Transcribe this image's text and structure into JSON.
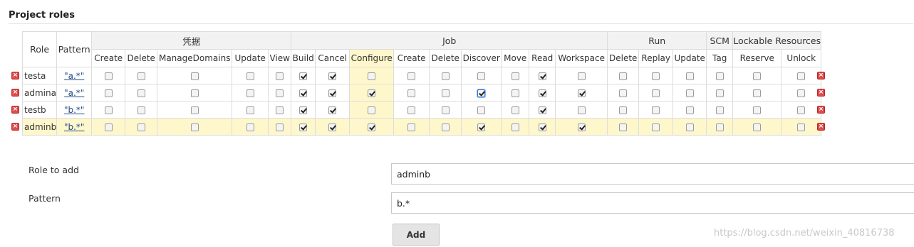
{
  "section_title": "Project roles",
  "table": {
    "role_header": "Role",
    "pattern_header": "Pattern",
    "groups": [
      {
        "name": "凭据",
        "permissions": [
          "Create",
          "Delete",
          "ManageDomains",
          "Update",
          "View"
        ]
      },
      {
        "name": "Job",
        "permissions": [
          "Build",
          "Cancel",
          "Configure",
          "Create",
          "Delete",
          "Discover",
          "Move",
          "Read",
          "Workspace"
        ]
      },
      {
        "name": "Run",
        "permissions": [
          "Delete",
          "Replay",
          "Update"
        ]
      },
      {
        "name": "SCM",
        "permissions": [
          "Tag"
        ]
      },
      {
        "name": "Lockable Resources",
        "permissions": [
          "Reserve",
          "Unlock"
        ]
      }
    ],
    "highlighted_column": "Job/Configure",
    "rows": [
      {
        "role": "testa",
        "pattern": "\"a.*\"",
        "checked": [
          "Job/Build",
          "Job/Cancel",
          "Job/Read"
        ]
      },
      {
        "role": "admina",
        "pattern": "\"a.*\"",
        "checked": [
          "Job/Build",
          "Job/Cancel",
          "Job/Configure",
          "Job/Discover",
          "Job/Read",
          "Job/Workspace"
        ],
        "focused": "Job/Discover"
      },
      {
        "role": "testb",
        "pattern": "\"b.*\"",
        "checked": [
          "Job/Build",
          "Job/Cancel",
          "Job/Read"
        ]
      },
      {
        "role": "adminb",
        "pattern": "\"b.*\"",
        "checked": [
          "Job/Build",
          "Job/Cancel",
          "Job/Configure",
          "Job/Discover",
          "Job/Read",
          "Job/Workspace"
        ],
        "hovered": true
      }
    ]
  },
  "form": {
    "role_label": "Role to add",
    "role_value": "adminb",
    "pattern_label": "Pattern",
    "pattern_value": "b.*",
    "add_button": "Add"
  },
  "watermark": "https://blog.csdn.net/weixin_40816738",
  "colors": {
    "highlight": "#fff7cc",
    "link": "#204a87",
    "delete_icon": "#e04a4a"
  },
  "icons": {
    "delete": "delete-role-icon",
    "checkbox": "permission-checkbox"
  }
}
